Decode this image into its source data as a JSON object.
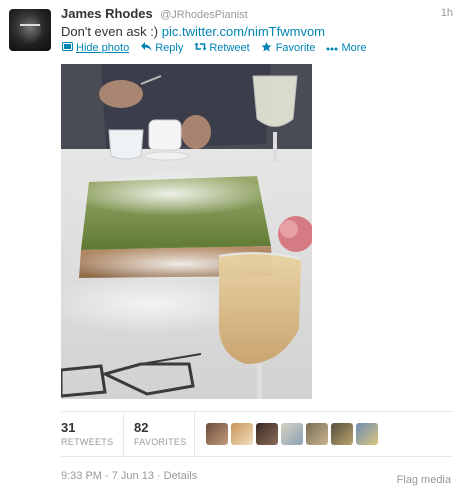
{
  "tweet": {
    "fullname": "James Rhodes",
    "username": "@JRhodesPianist",
    "time": "1h",
    "text": "Don't even ask :)",
    "link": "pic.twitter.com/nimTfwmvom",
    "actions": {
      "hide_photo": "Hide photo",
      "reply": "Reply",
      "retweet": "Retweet",
      "favorite": "Favorite",
      "more": "More"
    },
    "stats": {
      "retweets_count": "31",
      "retweets_label": "RETWEETS",
      "favorites_count": "82",
      "favorites_label": "FAVORITES"
    },
    "footer": {
      "timestamp": "9:33 PM - 7 Jun 13",
      "separator": "·",
      "details": "Details",
      "flag_media": "Flag media"
    }
  },
  "colors": {
    "link": "#0084b4",
    "muted": "#999999",
    "text": "#333333"
  },
  "icons": {
    "hide_photo": "photo-icon",
    "reply": "reply-arrow-icon",
    "retweet": "retweet-icon",
    "favorite": "star-icon",
    "more": "more-dots-icon"
  }
}
